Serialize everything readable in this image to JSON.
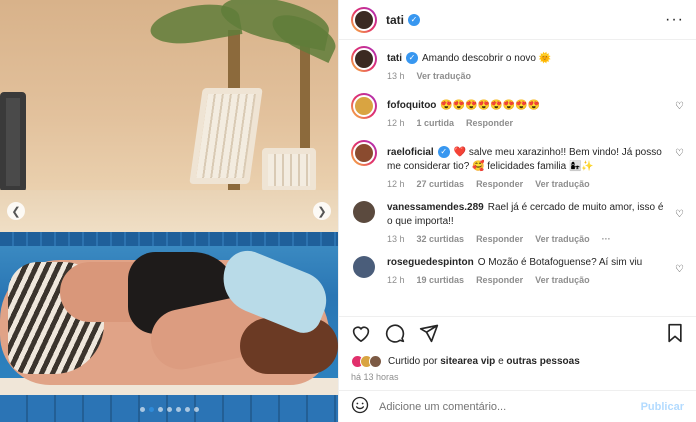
{
  "post": {
    "author": "tati",
    "caption": "Amando descobrir o novo 🌞",
    "caption_time": "13 h",
    "caption_translate": "Ver tradução"
  },
  "comments": [
    {
      "name": "fofoquitoo",
      "text": "😍😍😍😍😍😍😍😍",
      "time": "12 h",
      "likes": "1 curtida",
      "reply": "Responder",
      "translate": "",
      "avatar_color": "#d9a441"
    },
    {
      "name": "raeloficial",
      "text": "❤️ salve meu xarazinho!! Bem vindo! Já posso me considerar tio? 🥰 felicidades familia 👩‍👧✨",
      "time": "12 h",
      "likes": "27 curtidas",
      "reply": "Responder",
      "translate": "Ver tradução",
      "avatar_color": "#8a4b2f"
    },
    {
      "name": "vanessamendes.289",
      "text": "Rael já é cercado de muito amor, isso é o que importa!!",
      "time": "13 h",
      "likes": "32 curtidas",
      "reply": "Responder",
      "translate": "Ver tradução",
      "avatar_color": "#5b4a3e"
    },
    {
      "name": "roseguedespinton",
      "text": "O Mozão é Botafoguense? Aí sim viu",
      "time": "12 h",
      "likes": "19 curtidas",
      "reply": "Responder",
      "translate": "Ver tradução",
      "avatar_color": "#4a5d7a"
    }
  ],
  "likes": {
    "prefix": "Curtido por",
    "user": "sitearea vip",
    "and": "e",
    "others": "outras pessoas"
  },
  "timestamp": "há 13 horas",
  "composer": {
    "placeholder": "Adicione um comentário...",
    "publish": "Publicar"
  },
  "icons": {
    "heart": "heart-icon",
    "comment": "comment-icon",
    "share": "share-icon",
    "save": "bookmark-icon",
    "emoji": "emoji-icon",
    "more": "more-icon"
  }
}
